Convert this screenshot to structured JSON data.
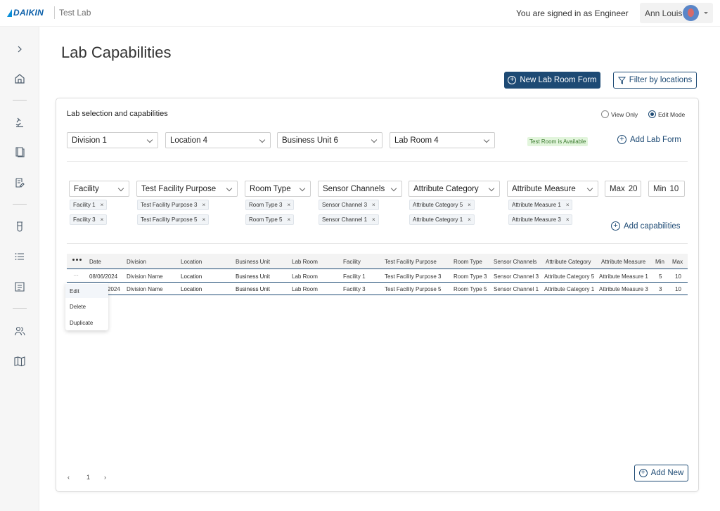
{
  "header": {
    "logo_text": "DAIKIN",
    "app_name": "Test Lab",
    "signed_in_text": "You are signed in as Engineer",
    "user_name": "Ann Louis"
  },
  "sidebar": {
    "items": [
      "chevron-right-icon",
      "home-icon",
      "microscope-icon",
      "book-icon",
      "edit-document-icon",
      "test-tube-icon",
      "list-icon",
      "document-icon",
      "users-icon",
      "map-icon"
    ]
  },
  "page": {
    "title": "Lab Capabilities",
    "new_lab_room_form": "New Lab Room Form",
    "filter_by_locations": "Filter by locations"
  },
  "card": {
    "title": "Lab selection and capabilities",
    "view_only": "View Only",
    "edit_mode": "Edit Mode",
    "division": "Division 1",
    "location": "Location 4",
    "business_unit": "Business Unit 6",
    "lab_room": "Lab Room 4",
    "status_badge": "Test Room is Available",
    "add_lab_form": "Add Lab Form",
    "filters": {
      "facility": "Facility",
      "purpose": "Test Facility Purpose",
      "room_type": "Room Type",
      "sensor": "Sensor Channels",
      "attr_category": "Attribute Category",
      "attr_measure": "Attribute Measure",
      "max_label": "Max",
      "max_value": "20",
      "min_label": "Min",
      "min_value": "10"
    },
    "chips": {
      "facility": [
        "Facility 1",
        "Facility 3"
      ],
      "purpose": [
        "Test Facility Purpose 3",
        "Test Facility Purpose 5"
      ],
      "room_type": [
        "Room Type 3",
        "Room Type 5"
      ],
      "sensor": [
        "Sensor Channel 3",
        "Sensor Channel 1"
      ],
      "attr_category": [
        "Attribute Category 5",
        "Attribute Category 1"
      ],
      "attr_measure": [
        "Attribute Measure 1",
        "Attribute Measure 3"
      ]
    },
    "add_capabilities": "Add capabilities"
  },
  "table": {
    "headers": [
      "Date",
      "Division",
      "Location",
      "Business Unit",
      "Lab Room",
      "Facility",
      "Test Facility Purpose",
      "Room Type",
      "Sensor Channels",
      "Attribute Category",
      "Attribute Measure",
      "Min",
      "Max"
    ],
    "rows": [
      {
        "date": "08/06/2024",
        "division": "Division Name",
        "location": "Location",
        "business_unit": "Business Unit",
        "lab_room": "Lab Room",
        "facility": "Facility 1",
        "purpose": "Test Facility Purpose 3",
        "room_type": "Room Type 3",
        "sensor": "Sensor Channel 3",
        "attr_category": "Attribute Category 5",
        "attr_measure": "Attribute Measure 1",
        "min": "5",
        "max": "10"
      },
      {
        "date": "2024",
        "division": "Division Name",
        "location": "Location",
        "business_unit": "Business Unit",
        "lab_room": "Lab Room",
        "facility": "Facility 3",
        "purpose": "Test Facility Purpose 5",
        "room_type": "Room Type 5",
        "sensor": "Sensor Channel 1",
        "attr_category": "Attribute Category 1",
        "attr_measure": "Attribute Measure 3",
        "min": "3",
        "max": "10"
      }
    ],
    "row_menu": [
      "Edit",
      "Delete",
      "Duplicate"
    ]
  },
  "pager": {
    "page": "1",
    "prev": "‹",
    "next": "›"
  },
  "add_new": "Add New",
  "colors": {
    "primary": "#1d4a74",
    "brand": "#0a5ea8",
    "status_bg": "#e2f5dc",
    "status_text": "#3b7a2e"
  }
}
